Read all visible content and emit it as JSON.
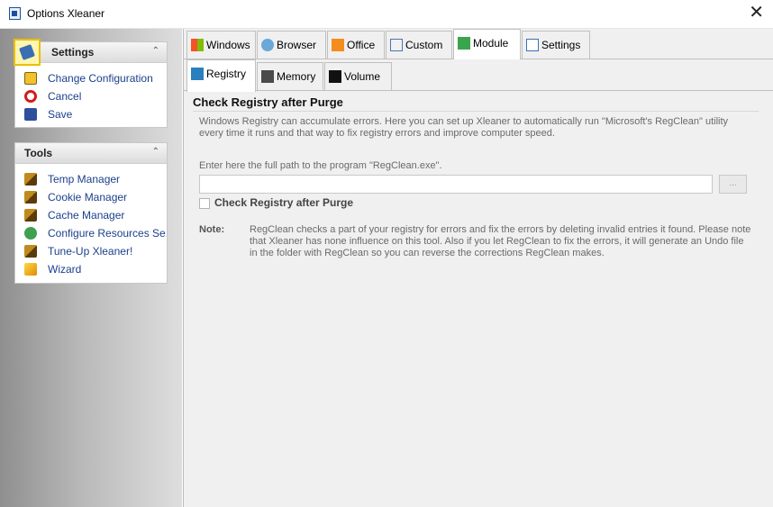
{
  "window": {
    "title": "Options Xleaner",
    "close_glyph": "✕"
  },
  "settings_panel": {
    "title": "Settings",
    "items": [
      {
        "label": "Change Configuration",
        "icon": "change-config-icon"
      },
      {
        "label": "Cancel",
        "icon": "cancel-icon"
      },
      {
        "label": "Save",
        "icon": "save-icon"
      }
    ]
  },
  "tools_panel": {
    "title": "Tools",
    "items": [
      {
        "label": "Temp Manager",
        "icon": "broom-icon"
      },
      {
        "label": "Cookie Manager",
        "icon": "broom-icon"
      },
      {
        "label": "Cache Manager",
        "icon": "broom-icon"
      },
      {
        "label": "Configure Resources Se...",
        "icon": "resources-icon"
      },
      {
        "label": "Tune-Up Xleaner!",
        "icon": "broom-icon"
      },
      {
        "label": "Wizard",
        "icon": "wizard-icon"
      }
    ]
  },
  "tabs_row1": [
    {
      "label": "Windows",
      "icon": "windows-icon"
    },
    {
      "label": "Browser",
      "icon": "browser-icon"
    },
    {
      "label": "Office",
      "icon": "office-icon"
    },
    {
      "label": "Custom",
      "icon": "custom-icon"
    },
    {
      "label": "Module",
      "icon": "module-icon",
      "active": true
    },
    {
      "label": "Settings",
      "icon": "settings-icon"
    }
  ],
  "tabs_row2": [
    {
      "label": "Registry",
      "icon": "registry-icon",
      "active": true
    },
    {
      "label": "Memory",
      "icon": "memory-icon"
    },
    {
      "label": "Volume",
      "icon": "volume-icon"
    }
  ],
  "registry": {
    "title": "Check Registry after Purge",
    "description": "Windows Registry can accumulate errors. Here you can set up Xleaner to automatically run \"Microsoft's RegClean\" utility every time it runs and that way to fix registry errors and improve computer speed.",
    "path_label": "Enter here the full path to the program \"RegClean.exe\".",
    "path_value": "",
    "browse_label": "...",
    "checkbox_label": "Check Registry after Purge",
    "checkbox_checked": false,
    "note_label": "Note:",
    "note_text": "RegClean checks a part of your registry for errors and fix the errors by deleting invalid entries it found. Please note that Xleaner has none influence on this tool. Also if you let RegClean to fix the errors, it will generate an Undo file in the folder with RegClean so you can reverse the corrections RegClean makes."
  }
}
